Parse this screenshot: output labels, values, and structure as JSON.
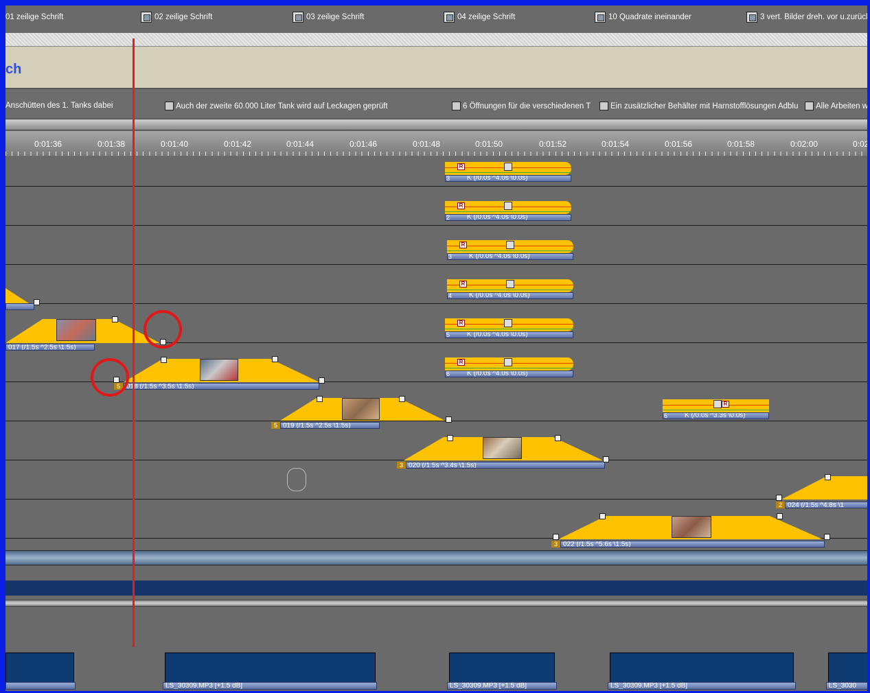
{
  "titlebar": {
    "items": [
      {
        "label": "01 zeilige Schrift"
      },
      {
        "label": "02 zeilige Schrift"
      },
      {
        "label": "03 zeilige Schrift"
      },
      {
        "label": "04 zeilige Schrift"
      },
      {
        "label": "10 Quadrate ineinander"
      },
      {
        "label": "3 vert. Bilder dreh. vor u.zurück"
      }
    ]
  },
  "title_track": {
    "text": "ch"
  },
  "captions": [
    {
      "text": "Anschütten des 1. Tanks dabei"
    },
    {
      "text": "Auch der zweite 60.000 Liter Tank wird auf Leckagen geprüft"
    },
    {
      "text": "6 Öffnungen für die verschiedenen T"
    },
    {
      "text": "Ein zusätzlicher Behälter mit Harnstofflösungen Adblu"
    },
    {
      "text": "Alle Arbeiten w"
    }
  ],
  "ruler": {
    "labels": [
      "0:01:36",
      "0:01:38",
      "0:01:40",
      "0:01:42",
      "0:01:44",
      "0:01:46",
      "0:01:48",
      "0:01:50",
      "0:01:52",
      "0:01:54",
      "0:01:56",
      "0:01:58",
      "0:02:00",
      "0:02"
    ]
  },
  "clips": {
    "c017": {
      "label": "017 (/1.5s ^2.5s \\1.5s)",
      "num": ""
    },
    "c018": {
      "label": "018 (/1.5s ^3.5s \\1.5s)",
      "num": "5"
    },
    "c019": {
      "label": "019 (/1.5s ^2.5s \\1.5s)",
      "num": "5"
    },
    "c020": {
      "label": "020 (/1.5s ^3.4s \\1.5s)",
      "num": "3"
    },
    "c022": {
      "label": "022 (/1.5s ^5.6s \\1.5s)",
      "num": "3"
    },
    "c024": {
      "label": "024 (/1.5s ^4.8s \\1",
      "num": "2"
    }
  },
  "fx_clips": [
    {
      "num": "3",
      "label": "K (/0.0s ^4.0s \\0.0s)"
    },
    {
      "num": "2",
      "label": "K (/0.0s ^4.0s \\0.0s)"
    },
    {
      "num": "3",
      "label": "K (/0.0s ^4.0s \\0.0s)"
    },
    {
      "num": "4",
      "label": "K (/0.0s ^4.0s \\0.0s)"
    },
    {
      "num": "5",
      "label": "K (/0.0s ^4.0s \\0.0s)"
    },
    {
      "num": "6",
      "label": "K (/0.0s ^4.0s \\0.0s)"
    }
  ],
  "fx_clip_right": {
    "num": "6",
    "label": "K (/0.0s ^3.3s \\0.0s)"
  },
  "audio_clips": [
    {
      "label": "LS_30309.MP3 [+1.5 dB]"
    },
    {
      "label": "LS_30309.MP3 [+1.5 dB]"
    },
    {
      "label": "LS_30309.MP3 [+1.5 dB]"
    },
    {
      "label": "LS_3030"
    }
  ],
  "colors": {
    "accent_frame": "#0a1fe6",
    "clip_fill": "#ffc200",
    "playhead": "#e81c1c",
    "annotation_ring": "#e01818"
  }
}
